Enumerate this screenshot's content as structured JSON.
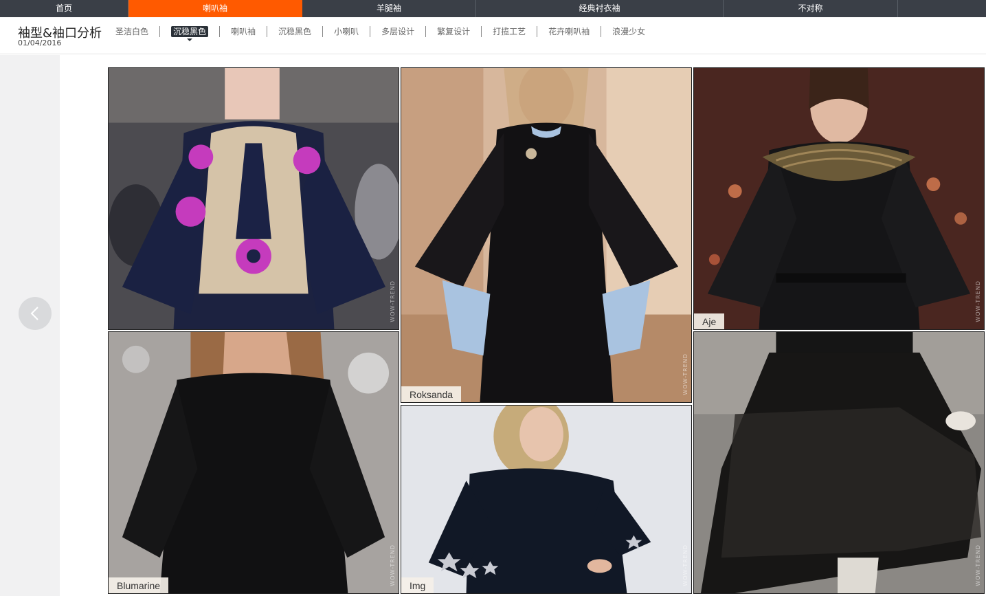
{
  "topnav": {
    "tabs": [
      {
        "label": "首页"
      },
      {
        "label": "喇叭袖"
      },
      {
        "label": "羊腿袖"
      },
      {
        "label": "经典衬衣袖"
      },
      {
        "label": "不对称"
      }
    ],
    "active_index": 1
  },
  "header": {
    "title": "袖型&袖口分析",
    "date": "01/04/2016"
  },
  "subnav": {
    "items": [
      {
        "label": "圣洁白色"
      },
      {
        "label": "沉稳黑色"
      },
      {
        "label": "喇叭袖"
      },
      {
        "label": "沉稳黑色"
      },
      {
        "label": "小喇叭"
      },
      {
        "label": "多层设计"
      },
      {
        "label": "繁复设计"
      },
      {
        "label": "打揽工艺"
      },
      {
        "label": "花卉喇叭袖"
      },
      {
        "label": "浪漫少女"
      }
    ],
    "active_index": 1
  },
  "gallery": {
    "watermark": "WOW-TREND",
    "tiles": [
      {
        "caption": ""
      },
      {
        "caption": "Roksanda"
      },
      {
        "caption": "Aje"
      },
      {
        "caption": "Blumarine"
      },
      {
        "caption": "Img"
      },
      {
        "caption": ""
      }
    ]
  },
  "icons": {
    "prev": "chevron-left-icon"
  },
  "colors": {
    "nav_bg": "#3a3f47",
    "accent": "#ff5a00",
    "active_chip": "#2b3138"
  }
}
